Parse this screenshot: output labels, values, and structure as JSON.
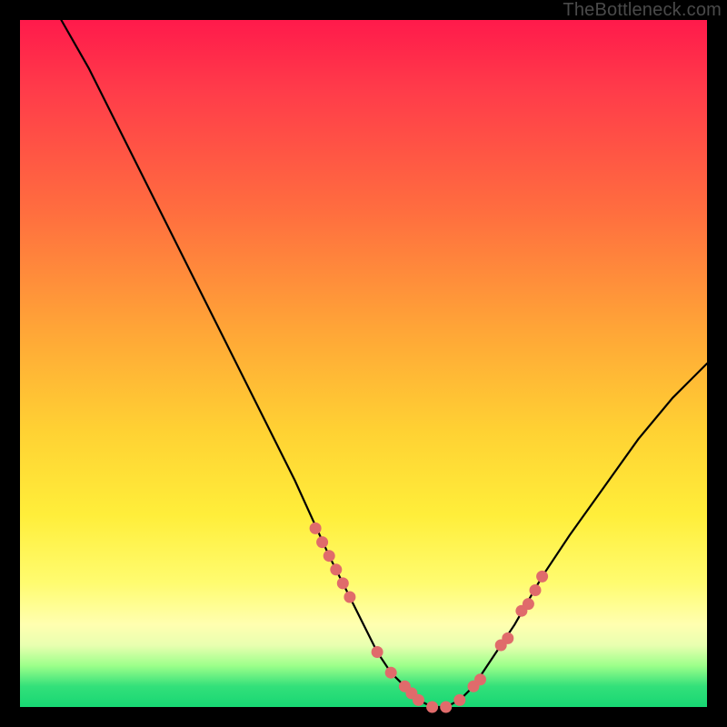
{
  "watermark": "TheBottleneck.com",
  "chart_data": {
    "type": "line",
    "title": "",
    "xlabel": "",
    "ylabel": "",
    "xlim": [
      0,
      100
    ],
    "ylim": [
      0,
      100
    ],
    "grid": false,
    "legend": false,
    "series": [
      {
        "name": "bottleneck-curve",
        "color": "#000000",
        "x": [
          6,
          10,
          15,
          20,
          25,
          30,
          35,
          40,
          45,
          48,
          50,
          52,
          54,
          56,
          58,
          60,
          62,
          64,
          66,
          68,
          72,
          76,
          80,
          85,
          90,
          95,
          100
        ],
        "y": [
          100,
          93,
          83,
          73,
          63,
          53,
          43,
          33,
          22,
          16,
          12,
          8,
          5,
          3,
          1,
          0,
          0,
          1,
          3,
          6,
          12,
          19,
          25,
          32,
          39,
          45,
          50
        ]
      }
    ],
    "highlight_points": {
      "name": "optimal-range-dots",
      "color": "#e06b6b",
      "x": [
        43,
        44,
        45,
        46,
        47,
        48,
        52,
        54,
        56,
        57,
        58,
        60,
        62,
        64,
        66,
        67,
        70,
        71,
        73,
        74,
        75,
        76
      ],
      "y": [
        26,
        24,
        22,
        20,
        18,
        16,
        8,
        5,
        3,
        2,
        1,
        0,
        0,
        1,
        3,
        4,
        9,
        10,
        14,
        15,
        17,
        19
      ]
    }
  }
}
